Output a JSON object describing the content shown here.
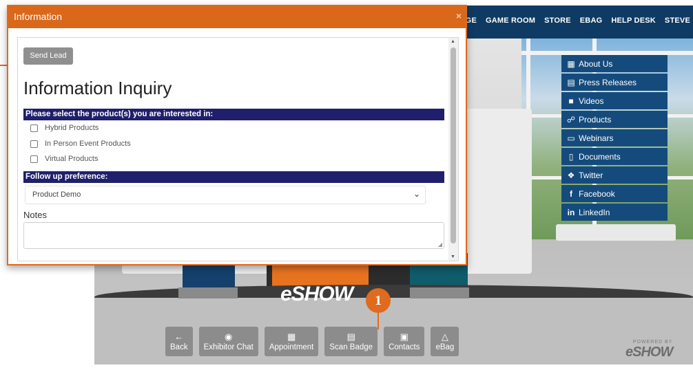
{
  "top_nav": [
    "LOUNGE",
    "GAME ROOM",
    "STORE",
    "EBAG",
    "HELP DESK",
    "STEVE"
  ],
  "side_menu": [
    {
      "label": "About Us",
      "icon": "building-icon"
    },
    {
      "label": "Press Releases",
      "icon": "newspaper-icon"
    },
    {
      "label": "Videos",
      "icon": "video-camera-icon"
    },
    {
      "label": "Products",
      "icon": "shopping-cart-icon"
    },
    {
      "label": "Webinars",
      "icon": "monitor-icon"
    },
    {
      "label": "Documents",
      "icon": "document-icon"
    },
    {
      "label": "Twitter",
      "icon": "twitter-icon"
    },
    {
      "label": "Facebook",
      "icon": "facebook-icon"
    },
    {
      "label": "LinkedIn",
      "icon": "linkedin-icon"
    }
  ],
  "toolbar": [
    {
      "label": "Back",
      "icon": "arrow-left-icon"
    },
    {
      "label": "Exhibitor Chat",
      "icon": "chat-bubbles-icon"
    },
    {
      "label": "Appointment",
      "icon": "calendar-icon"
    },
    {
      "label": "Scan Badge",
      "icon": "barcode-icon"
    },
    {
      "label": "Contacts",
      "icon": "contact-card-icon"
    },
    {
      "label": "eBag",
      "icon": "shopping-bag-icon"
    }
  ],
  "callout_number": "1",
  "booth_logo": "eSHOW",
  "powered_by": {
    "line1": "POWERED BY",
    "line2": "eSHOW"
  },
  "modal": {
    "title": "Information",
    "close": "×",
    "send_lead_label": "Send Lead",
    "heading": "Information Inquiry",
    "products_prompt": "Please select the product(s) you are interested in:",
    "products": [
      "Hybrid Products",
      "In Person Event Products",
      "Virtual Products"
    ],
    "followup_prompt": "Follow up preference:",
    "followup_selected": "Product Demo",
    "notes_label": "Notes",
    "notes_value": ""
  },
  "colors": {
    "accent_orange": "#e06a1d",
    "nav_blue": "#0f3a63",
    "menu_blue": "#154b7c",
    "section_bar": "#1f1f6b"
  }
}
